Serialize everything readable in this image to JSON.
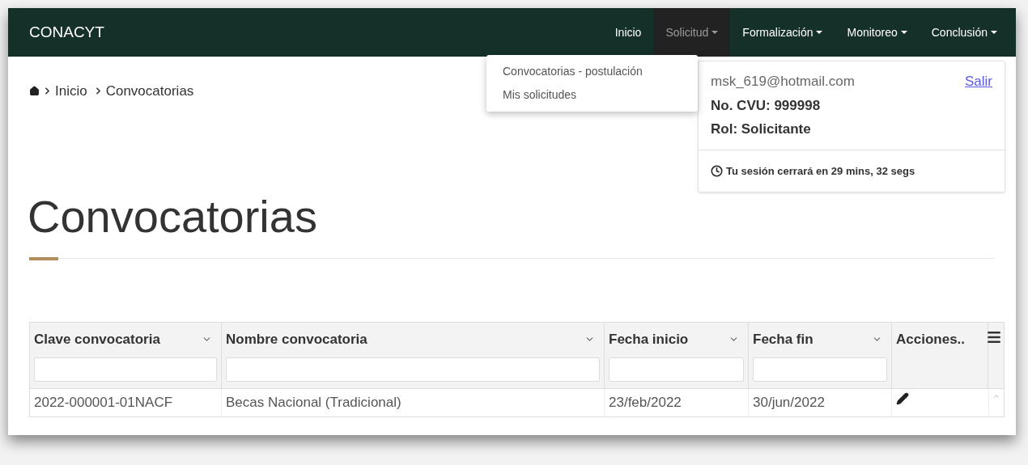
{
  "navbar": {
    "brand": "CONACYT",
    "items": [
      {
        "label": "Inicio",
        "dropdown": false,
        "selected": false
      },
      {
        "label": "Solicitud",
        "dropdown": true,
        "selected": true
      },
      {
        "label": "Formalización",
        "dropdown": true,
        "selected": false
      },
      {
        "label": "Monitoreo",
        "dropdown": true,
        "selected": false
      },
      {
        "label": "Conclusión",
        "dropdown": true,
        "selected": false
      }
    ]
  },
  "dropdown_menu": [
    "Convocatorias - postulación",
    "Mis solicitudes"
  ],
  "breadcrumb": [
    "Inicio",
    "Convocatorias"
  ],
  "user_card": {
    "email": "msk_619@hotmail.com",
    "logout": "Salir",
    "cvu": "No. CVU: 999998",
    "role": "Rol: Solicitante",
    "session": "Tu sesión cerrará en 29 mins, 32 segs"
  },
  "page_title": "Convocatorias",
  "table": {
    "columns": [
      {
        "label": "Clave convocatoria",
        "kind": "filter"
      },
      {
        "label": "Nombre convocatoria",
        "kind": "filter"
      },
      {
        "label": "Fecha inicio",
        "kind": "filter"
      },
      {
        "label": "Fecha fin",
        "kind": "filter"
      },
      {
        "label": "Acciones..",
        "kind": "actions"
      }
    ],
    "rows": [
      {
        "cells": [
          "2022-000001-01NACF",
          "Becas Nacional (Tradicional)",
          "23/feb/2022",
          "30/jun/2022"
        ]
      }
    ]
  }
}
